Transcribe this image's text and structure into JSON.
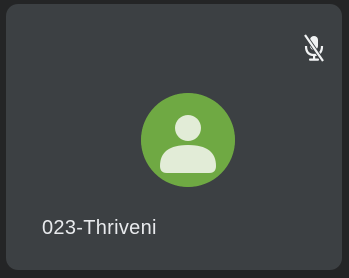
{
  "participant": {
    "name": "023-Thriveni",
    "mic_state": "muted",
    "mic_icon": "mic-off-icon",
    "avatar_icon": "person-icon"
  },
  "colors": {
    "tile_background": "#3c4043",
    "avatar_background": "#6fa943",
    "avatar_figure": "#e2ecd7",
    "text": "#e8eaed"
  }
}
